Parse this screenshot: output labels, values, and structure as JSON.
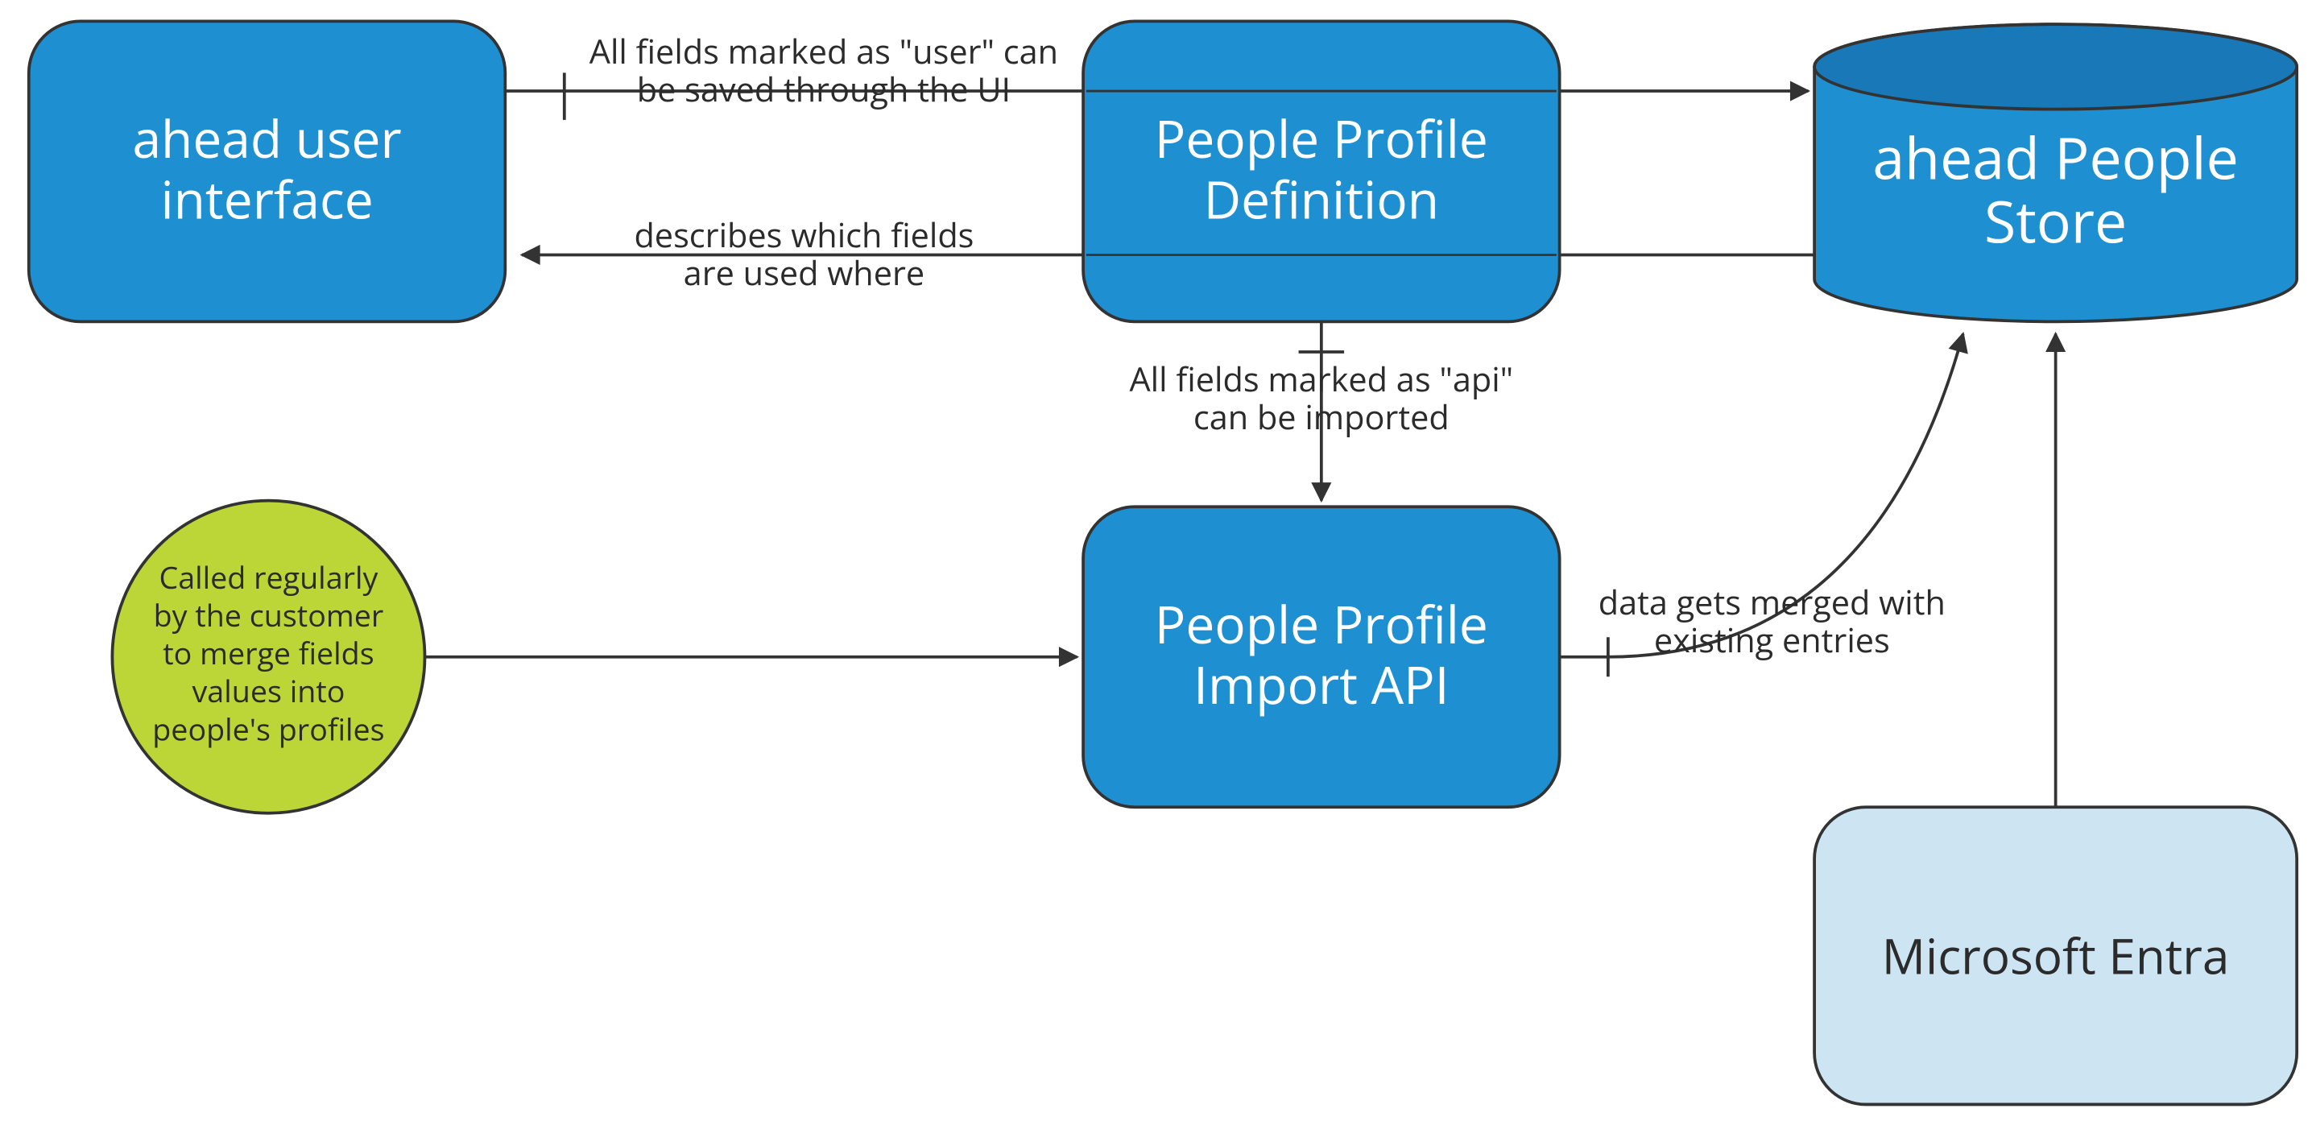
{
  "nodes": {
    "ui": {
      "l1": "ahead user",
      "l2": "interface"
    },
    "ppd": {
      "l1": "People Profile",
      "l2": "Definition"
    },
    "store": {
      "l1": "ahead People",
      "l2": "Store"
    },
    "api": {
      "l1": "People Profile",
      "l2": "Import API"
    },
    "entra": {
      "l1": "Microsoft Entra"
    },
    "circle": {
      "l1": "Called regularly",
      "l2": "by the customer",
      "l3": "to merge fields",
      "l4": "values into",
      "l5": "people's profiles"
    }
  },
  "edges": {
    "ui_to_ppd": {
      "l1": "All fields marked as \"user\" can",
      "l2": "be saved through the UI"
    },
    "ppd_to_ui": {
      "l1": "describes which fields",
      "l2": "are used where"
    },
    "ppd_to_api": {
      "l1": "All fields marked as \"api\"",
      "l2": "can be imported"
    },
    "api_to_store": {
      "l1": "data gets merged with",
      "l2": "existing entries"
    }
  },
  "colors": {
    "blue": "#1e90d2",
    "blueDark": "#1878b8",
    "lightBlue": "#cde5f3",
    "lime": "#bcd637",
    "stroke": "#333333"
  }
}
